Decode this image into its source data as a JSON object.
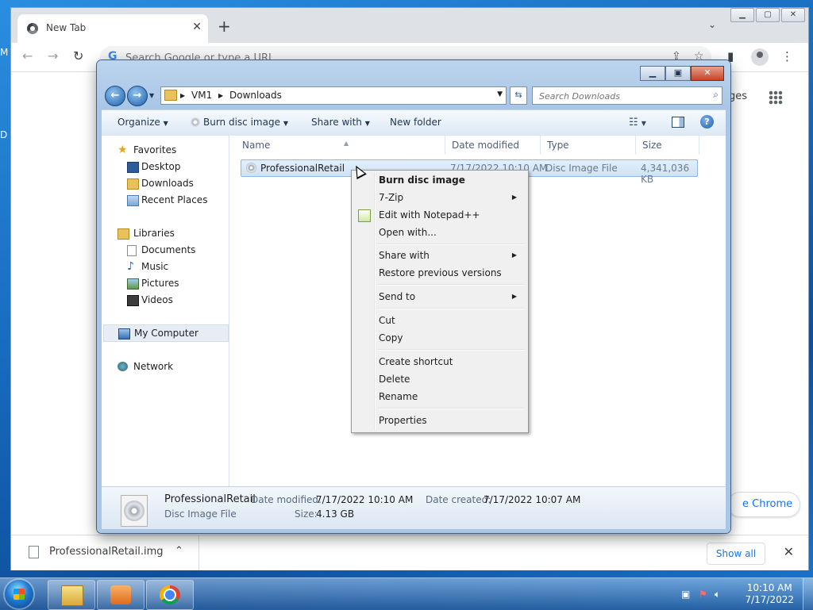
{
  "desktop": {
    "edge_text_1": "M",
    "edge_text_2": "D"
  },
  "chrome": {
    "tab_title": "New Tab",
    "omnibox_placeholder": "Search Google or type a URL",
    "bg_text_right": "ges",
    "customize_label": "e Chrome",
    "download": {
      "file_name": "ProfessionalRetail.img",
      "show_all": "Show all"
    }
  },
  "explorer": {
    "address": [
      "VM1",
      "Downloads"
    ],
    "search_placeholder": "Search Downloads",
    "commands": {
      "organize": "Organize",
      "burn": "Burn disc image",
      "share": "Share with",
      "new_folder": "New folder"
    },
    "nav": {
      "favorites": "Favorites",
      "desktop": "Desktop",
      "downloads": "Downloads",
      "recent": "Recent Places",
      "libraries": "Libraries",
      "documents": "Documents",
      "music": "Music",
      "pictures": "Pictures",
      "videos": "Videos",
      "computer": "My Computer",
      "network": "Network"
    },
    "columns": {
      "name": "Name",
      "date": "Date modified",
      "type": "Type",
      "size": "Size"
    },
    "file": {
      "name": "ProfessionalRetail",
      "date": "7/17/2022 10:10 AM",
      "type": "Disc Image File",
      "size": "4,341,036 KB"
    },
    "details": {
      "name": "ProfessionalRetail",
      "type": "Disc Image File",
      "date_modified_label": "Date modified:",
      "date_modified": "7/17/2022 10:10 AM",
      "date_created_label": "Date created:",
      "date_created": "7/17/2022 10:07 AM",
      "size_label": "Size:",
      "size": "4.13 GB"
    }
  },
  "context_menu": {
    "burn": "Burn disc image",
    "zip": "7-Zip",
    "notepad": "Edit with Notepad++",
    "open_with": "Open with...",
    "share_with": "Share with",
    "restore": "Restore previous versions",
    "send_to": "Send to",
    "cut": "Cut",
    "copy": "Copy",
    "shortcut": "Create shortcut",
    "delete": "Delete",
    "rename": "Rename",
    "properties": "Properties"
  },
  "taskbar": {
    "time": "10:10 AM",
    "date": "7/17/2022"
  },
  "colors": {
    "accent": "#1a73e8",
    "selection": "#cfe2f6",
    "taskbar": "#285a96"
  }
}
